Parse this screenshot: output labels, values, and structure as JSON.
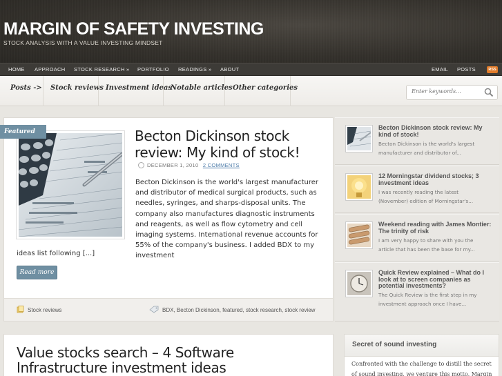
{
  "site": {
    "title": "MARGIN OF SAFETY INVESTING",
    "tagline": "STOCK ANALYSIS WITH A VALUE INVESTING MINDSET"
  },
  "topnav": {
    "items": [
      "HOME",
      "APPROACH",
      "STOCK RESEARCH »",
      "PORTFOLIO",
      "READINGS »",
      "ABOUT"
    ],
    "right_items": [
      "EMAIL",
      "POSTS"
    ],
    "rss_label": "RSS"
  },
  "catbar": {
    "items": [
      "Posts ->",
      "Stock reviews",
      "Investment ideas",
      "Notable articles",
      "Other categories"
    ],
    "search_placeholder": "Enter keywords..."
  },
  "featured": {
    "tag": "Featured",
    "title": "Becton Dickinson stock review: My kind of stock!",
    "date": "DECEMBER 1, 2010",
    "comments": "2 COMMENTS",
    "excerpt": "Becton Dickinson is the world's largest manufacturer and distributor of medical surgical products, such as needles, syringes, and sharps-disposal units. The company also manufactures diagnostic instruments and reagents, as well as flow cytometry and cell imaging systems. International revenue accounts for 55% of the company's business. I added BDX to my investment",
    "excerpt_tail": "ideas list following [...]",
    "read_more": "Read more",
    "category": "Stock reviews",
    "tags": "BDX, Becton Dickinson, featured, stock research, stock review"
  },
  "sidebar": {
    "items": [
      {
        "title": "Becton Dickinson stock review: My kind of stock!",
        "desc": "Becton Dickinson is the world's largest manufacturer and distributor of..."
      },
      {
        "title": "12 Morningstar dividend stocks; 3 investment ideas",
        "desc": "I was recently reading the latest (November) edition of Morningstar's..."
      },
      {
        "title": "Weekend reading with James Montier: The trinity of risk",
        "desc": "I am very happy to share with you the article that has been the base for my..."
      },
      {
        "title": "Quick Review explained – What do I look at to screen companies as potential investments?",
        "desc": "The Quick Review is the first step in my investment approach once I have..."
      }
    ]
  },
  "post2": {
    "title": "Value stocks search – 4 Software Infrastructure investment ideas"
  },
  "widget": {
    "title": "Secret of sound investing",
    "text": "Confronted with the challenge to distill the secret of sound investing, we venture this motto, Margin Of"
  }
}
